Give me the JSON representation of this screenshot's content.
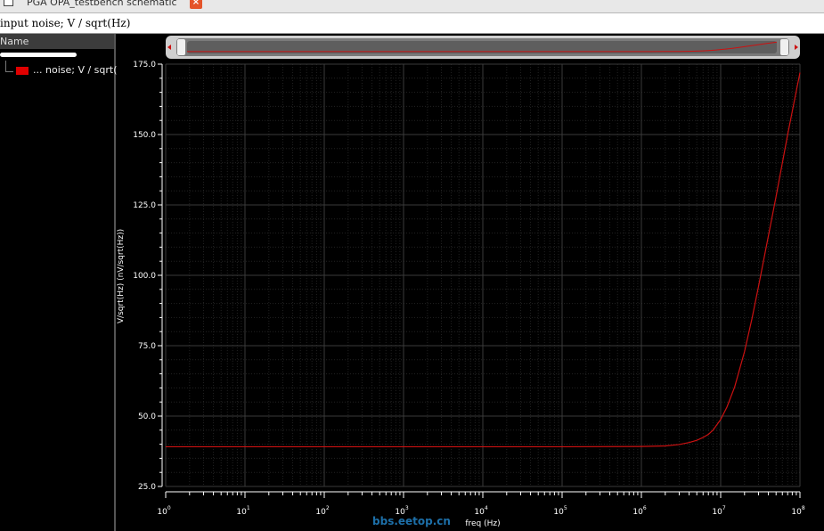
{
  "tab": {
    "title": "PGA OPA_testbench schematic",
    "close_glyph": "×"
  },
  "subtitle": "input noise; V / sqrt(Hz)",
  "panel": {
    "column_header": "Name",
    "legend_label": "... noise; V / sqrt("
  },
  "watermark": "bbs.eetop.cn",
  "colors": {
    "trace": "#cc1111",
    "grid_major": "#3a3a3a",
    "grid_minor": "#222222",
    "axis": "#ffffff",
    "background": "#000000"
  },
  "chart_data": {
    "type": "line",
    "xscale": "log",
    "xlim": [
      1,
      100000000
    ],
    "ylim": [
      25,
      175
    ],
    "xlabel": "freq (Hz)",
    "ylabel": "V/sqrt(Hz) (nV/sqrt(Hz))",
    "x_tick_labels": [
      {
        "base": "10",
        "exp": "0"
      },
      {
        "base": "10",
        "exp": "1"
      },
      {
        "base": "10",
        "exp": "2"
      },
      {
        "base": "10",
        "exp": "3"
      },
      {
        "base": "10",
        "exp": "4"
      },
      {
        "base": "10",
        "exp": "5"
      },
      {
        "base": "10",
        "exp": "6"
      },
      {
        "base": "10",
        "exp": "7"
      },
      {
        "base": "10",
        "exp": "8"
      }
    ],
    "y_ticks": [
      25,
      50,
      75,
      100,
      125,
      150,
      175
    ],
    "y_tick_labels": [
      "25.0",
      "50.0",
      "75.0",
      "100.0",
      "125.0",
      "150.0",
      "175.0"
    ],
    "grid": true,
    "series": [
      {
        "name": "... noise; V / sqrt(",
        "x": [
          1,
          10,
          100,
          1000,
          10000,
          100000,
          1000000,
          2000000,
          3000000,
          4000000,
          5000000,
          6000000,
          7000000,
          8000000,
          10000000,
          12000000,
          15000000,
          20000000,
          25000000,
          30000000,
          40000000,
          50000000,
          70000000,
          100000000
        ],
        "y": [
          39.1,
          39.1,
          39.1,
          39.1,
          39.1,
          39.1,
          39.2,
          39.4,
          39.9,
          40.6,
          41.4,
          42.4,
          43.5,
          45.0,
          48.8,
          53.2,
          60.3,
          72.9,
          85.0,
          96.0,
          114.0,
          128.0,
          150.0,
          172.0
        ]
      }
    ]
  }
}
